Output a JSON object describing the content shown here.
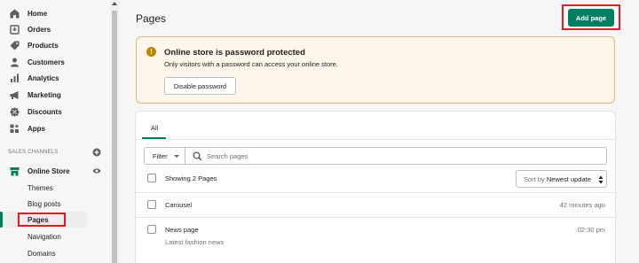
{
  "sidebar": {
    "items": [
      {
        "label": "Home",
        "icon": "home-icon"
      },
      {
        "label": "Orders",
        "icon": "orders-icon"
      },
      {
        "label": "Products",
        "icon": "tag-icon"
      },
      {
        "label": "Customers",
        "icon": "person-icon"
      },
      {
        "label": "Analytics",
        "icon": "bar-chart-icon"
      },
      {
        "label": "Marketing",
        "icon": "megaphone-icon"
      },
      {
        "label": "Discounts",
        "icon": "discount-icon"
      },
      {
        "label": "Apps",
        "icon": "apps-icon"
      }
    ],
    "section_heading": "SALES CHANNELS",
    "channel": {
      "label": "Online Store",
      "icon": "store-icon"
    },
    "sub_items": [
      "Themes",
      "Blog posts",
      "Pages",
      "Navigation",
      "Domains"
    ],
    "active_sub_item": "Pages"
  },
  "header": {
    "title": "Pages",
    "add_button": "Add page"
  },
  "banner": {
    "title": "Online store is password protected",
    "description": "Only visitors with a password can access your online store.",
    "button": "Disable password"
  },
  "list": {
    "tab": "All",
    "filter_label": "Filter",
    "search_placeholder": "Search pages",
    "showing": "Showing 2 Pages",
    "sort_prefix": "Sort by",
    "sort_value": "Newest update",
    "rows": [
      {
        "title": "Carousel",
        "subtitle": "",
        "time": "42 minutes ago"
      },
      {
        "title": "News page",
        "subtitle": "Latest fashion news",
        "time": "02:30 pm"
      }
    ]
  },
  "colors": {
    "accent": "#008060",
    "highlight": "#e01b24",
    "banner_bg": "#fff5ea"
  }
}
